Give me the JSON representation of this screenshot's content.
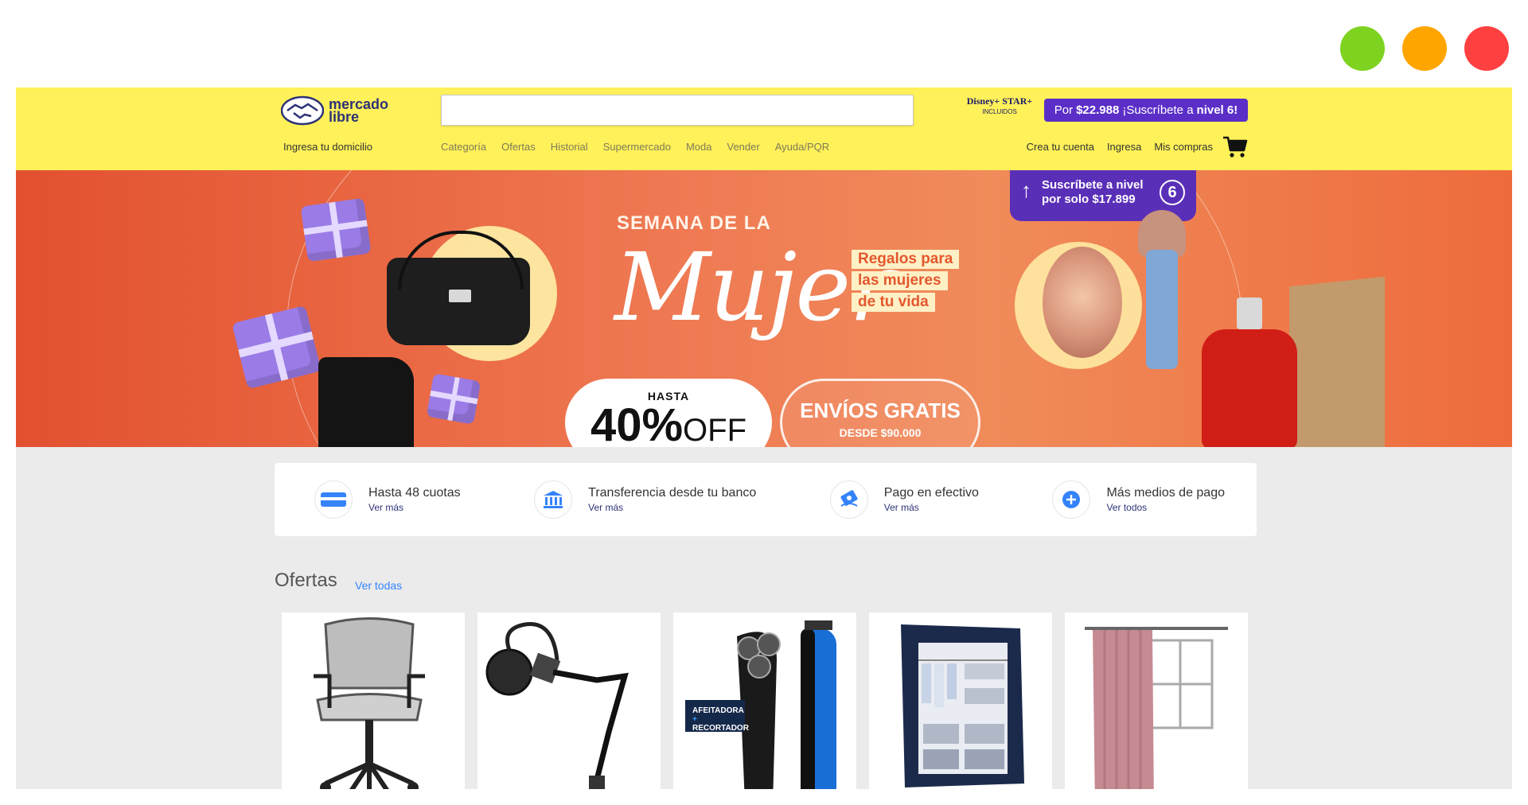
{
  "header": {
    "logo": {
      "line1": "mercado",
      "line2": "libre"
    },
    "search_placeholder": "",
    "disney": {
      "label": "Disney+ STAR+",
      "sub": "INCLUIDOS"
    },
    "promo": {
      "prefix": "Por",
      "price": "$22.988",
      "text": "¡Suscríbete a",
      "level": "nivel 6!"
    },
    "address_link": "Ingresa tu domicilio",
    "nav": [
      "Categoría",
      "Ofertas",
      "Historial",
      "Supermercado",
      "Moda",
      "Vender",
      "Ayuda/PQR"
    ],
    "account": [
      "Crea tu cuenta",
      "Ingresa",
      "Mis compras"
    ]
  },
  "banner": {
    "subscribe": {
      "line1": "Suscríbete a nivel",
      "line2": "por solo $17.899",
      "level": "6"
    },
    "title_top": "SEMANA DE LA",
    "title_main": "Mujer",
    "regalos": [
      "Regalos para",
      "las mujeres",
      "de tu vida"
    ],
    "discount": {
      "hasta": "HASTA",
      "pct": "40%",
      "off": "OFF"
    },
    "envios": {
      "big": "ENVÍOS GRATIS",
      "small": "DESDE $90.000"
    }
  },
  "payments": [
    {
      "title": "Hasta 48 cuotas",
      "link": "Ver más",
      "icon": "credit-card-icon"
    },
    {
      "title": "Transferencia desde tu banco",
      "link": "Ver más",
      "icon": "bank-icon"
    },
    {
      "title": "Pago en efectivo",
      "link": "Ver más",
      "icon": "cash-icon"
    },
    {
      "title": "Más medios de pago",
      "link": "Ver todos",
      "icon": "plus-icon"
    }
  ],
  "ofertas": {
    "title": "Ofertas",
    "link": "Ver todas",
    "items": [
      {
        "name": "office-chair"
      },
      {
        "name": "microphone-arm"
      },
      {
        "name": "shaver",
        "label1": "AFEITADORA",
        "label2": "+",
        "label3": "RECORTADOR"
      },
      {
        "name": "wardrobe"
      },
      {
        "name": "curtain"
      }
    ]
  },
  "colors": {
    "header_bg": "#fff159",
    "brand_blue": "#2d3277",
    "link_blue": "#3483fa",
    "promo_purple": "#5b2fc7"
  }
}
